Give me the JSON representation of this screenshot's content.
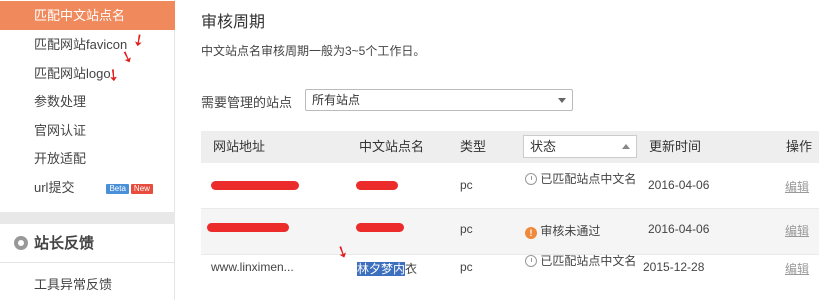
{
  "sidebar": {
    "items": [
      {
        "label": "匹配中文站点名"
      },
      {
        "label": "匹配网站favicon"
      },
      {
        "label": "匹配网站logo"
      },
      {
        "label": "参数处理"
      },
      {
        "label": "官网认证"
      },
      {
        "label": "开放适配"
      },
      {
        "label": "url提交",
        "badges": [
          "Beta",
          "New"
        ]
      }
    ],
    "section": {
      "label": "站长反馈"
    },
    "sub_items": [
      {
        "label": "工具异常反馈"
      }
    ]
  },
  "main": {
    "title": "审核周期",
    "description": "中文站点名审核周期一般为3~5个工作日。",
    "filter": {
      "label": "需要管理的站点",
      "selected": "所有站点"
    },
    "table": {
      "headers": [
        "网站地址",
        "中文站点名",
        "类型",
        "状态",
        "更新时间",
        "操作"
      ],
      "rows": [
        {
          "url": "",
          "name": "",
          "type": "pc",
          "status_icon": "clock-icon",
          "status": "已匹配站点中文名",
          "updated": "2016-04-06",
          "action": "编辑"
        },
        {
          "url": "",
          "name": "",
          "type": "pc",
          "status_icon": "warning-icon",
          "status": "审核未通过",
          "updated": "2016-04-06",
          "action": "编辑"
        },
        {
          "url": "www.linximen...",
          "name_highlight": "林夕梦内",
          "name_rest": "衣",
          "type": "pc",
          "status_icon": "clock-icon",
          "status": "已匹配站点中文名",
          "updated": "2015-12-28",
          "action": "编辑"
        }
      ]
    }
  },
  "colors": {
    "active": "#f08a5d",
    "redaction": "#ec2b2b",
    "header_bg": "#eeeeee"
  }
}
